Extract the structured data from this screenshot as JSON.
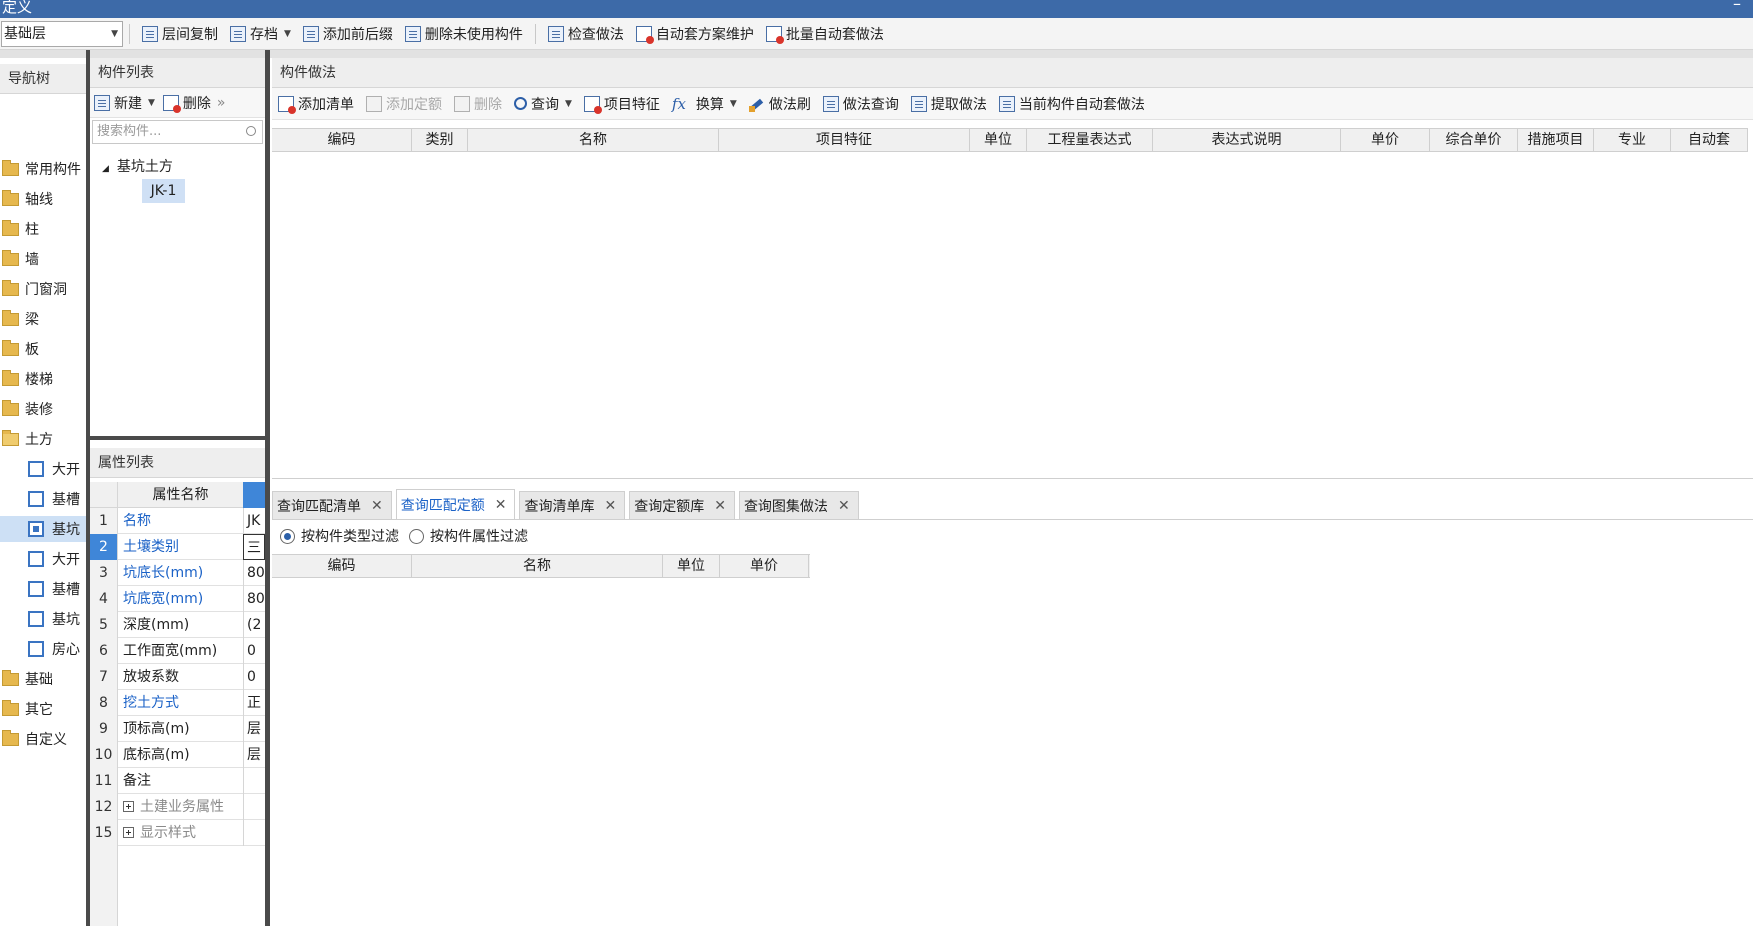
{
  "titlebar": {
    "title": "定义",
    "minimize": "–"
  },
  "toolbar": {
    "floor_value": "基础层",
    "buttons": [
      "层间复制",
      "存档",
      "添加前后缀",
      "删除未使用构件",
      "检查做法",
      "自动套方案维护",
      "批量自动套做法"
    ]
  },
  "nav": {
    "title": "导航树",
    "items": [
      "常用构件",
      "轴线",
      "柱",
      "墙",
      "门窗洞",
      "梁",
      "板",
      "楼梯",
      "装修",
      "土方"
    ],
    "sub_items": [
      "大开",
      "基槽",
      "基坑",
      "大开",
      "基槽",
      "基坑",
      "房心"
    ],
    "tail_items": [
      "基础",
      "其它",
      "自定义"
    ]
  },
  "component_list": {
    "title": "构件列表",
    "buttons": {
      "new": "新建",
      "delete": "删除",
      "more": "»"
    },
    "search_placeholder": "搜索构件...",
    "group": "基坑土方",
    "item": "JK-1"
  },
  "properties": {
    "title": "属性列表",
    "header": "属性名称",
    "rows": [
      {
        "num": "1",
        "name": "名称",
        "value": "JK"
      },
      {
        "num": "2",
        "name": "土壤类别",
        "value": "三"
      },
      {
        "num": "3",
        "name": "坑底长(mm)",
        "value": "80"
      },
      {
        "num": "4",
        "name": "坑底宽(mm)",
        "value": "80"
      },
      {
        "num": "5",
        "name": "深度(mm)",
        "value": "(2"
      },
      {
        "num": "6",
        "name": "工作面宽(mm)",
        "value": "0"
      },
      {
        "num": "7",
        "name": "放坡系数",
        "value": "0"
      },
      {
        "num": "8",
        "name": "挖土方式",
        "value": "正"
      },
      {
        "num": "9",
        "name": "顶标高(m)",
        "value": "层"
      },
      {
        "num": "10",
        "name": "底标高(m)",
        "value": "层"
      },
      {
        "num": "11",
        "name": "备注",
        "value": ""
      },
      {
        "num": "12",
        "name": "土建业务属性",
        "value": ""
      },
      {
        "num": "15",
        "name": "显示样式",
        "value": ""
      }
    ]
  },
  "method": {
    "title": "构件做法",
    "buttons": [
      "添加清单",
      "添加定额",
      "删除",
      "查询",
      "项目特征",
      "换算",
      "做法刷",
      "做法查询",
      "提取做法",
      "当前构件自动套做法"
    ],
    "columns": [
      "编码",
      "类别",
      "名称",
      "项目特征",
      "单位",
      "工程量表达式",
      "表达式说明",
      "单价",
      "综合单价",
      "措施项目",
      "专业",
      "自动套"
    ]
  },
  "query": {
    "tabs": [
      "查询匹配清单",
      "查询匹配定额",
      "查询清单库",
      "查询定额库",
      "查询图集做法"
    ],
    "active_tab": "查询匹配定额",
    "filters": [
      "按构件类型过滤",
      "按构件属性过滤"
    ],
    "columns": [
      "编码",
      "名称",
      "单位",
      "单价"
    ]
  },
  "colors": {
    "accent": "#3d6aa8",
    "selection": "#cde0f5",
    "link": "#1b62c7"
  }
}
